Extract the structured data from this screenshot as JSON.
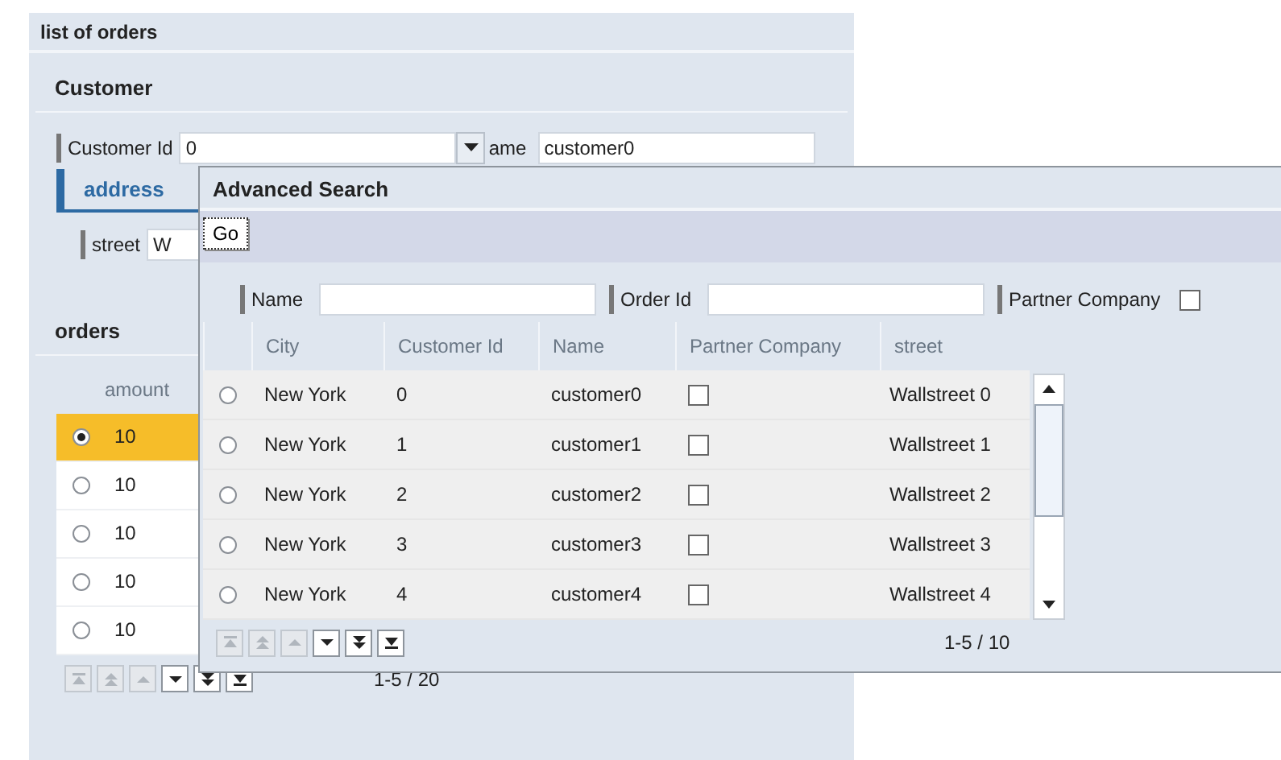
{
  "page": {
    "title": "list of orders",
    "customer": {
      "title": "Customer",
      "fields": [
        {
          "label": "Customer Id",
          "value": "0"
        },
        {
          "label": "ame",
          "value": "customer0"
        }
      ],
      "tabs": [
        {
          "label": "address",
          "selected": true
        }
      ],
      "street": {
        "label": "street",
        "value": "W"
      }
    },
    "orders": {
      "title": "orders",
      "columns": [
        "amount"
      ],
      "rows": [
        {
          "amount": "10",
          "selected": true
        },
        {
          "amount": "10",
          "selected": false
        },
        {
          "amount": "10",
          "selected": false
        },
        {
          "amount": "10",
          "selected": false
        },
        {
          "amount": "10",
          "selected": false
        }
      ],
      "pager": {
        "buttons": [
          {
            "kind": "first",
            "disabled": true
          },
          {
            "kind": "prev-page",
            "disabled": true
          },
          {
            "kind": "prev",
            "disabled": true
          },
          {
            "kind": "next",
            "disabled": false
          },
          {
            "kind": "next-page",
            "disabled": false
          },
          {
            "kind": "last",
            "disabled": false
          }
        ],
        "range": "1-5 / 20"
      }
    }
  },
  "dialog": {
    "title": "Advanced Search",
    "go_button": "Go",
    "search_fields": [
      {
        "label": "Name",
        "kind": "text"
      },
      {
        "label": "Order Id",
        "kind": "text"
      },
      {
        "label": "Partner Company",
        "kind": "checkbox",
        "checked": false
      }
    ],
    "columns": [
      "City",
      "Customer Id",
      "Name",
      "Partner Company",
      "street"
    ],
    "rows": [
      {
        "city": "New York",
        "customer_id": "0",
        "name": "customer0",
        "partner_company": false,
        "street": "Wallstreet 0",
        "selected": false
      },
      {
        "city": "New York",
        "customer_id": "1",
        "name": "customer1",
        "partner_company": false,
        "street": "Wallstreet 1",
        "selected": false
      },
      {
        "city": "New York",
        "customer_id": "2",
        "name": "customer2",
        "partner_company": false,
        "street": "Wallstreet 2",
        "selected": false
      },
      {
        "city": "New York",
        "customer_id": "3",
        "name": "customer3",
        "partner_company": false,
        "street": "Wallstreet 3",
        "selected": false
      },
      {
        "city": "New York",
        "customer_id": "4",
        "name": "customer4",
        "partner_company": false,
        "street": "Wallstreet 4",
        "selected": false
      }
    ],
    "pager": {
      "buttons": [
        {
          "kind": "first",
          "disabled": true
        },
        {
          "kind": "prev-page",
          "disabled": true
        },
        {
          "kind": "prev",
          "disabled": true
        },
        {
          "kind": "next",
          "disabled": false
        },
        {
          "kind": "next-page",
          "disabled": false
        },
        {
          "kind": "last",
          "disabled": false
        }
      ],
      "range": "1-5 / 10"
    }
  }
}
